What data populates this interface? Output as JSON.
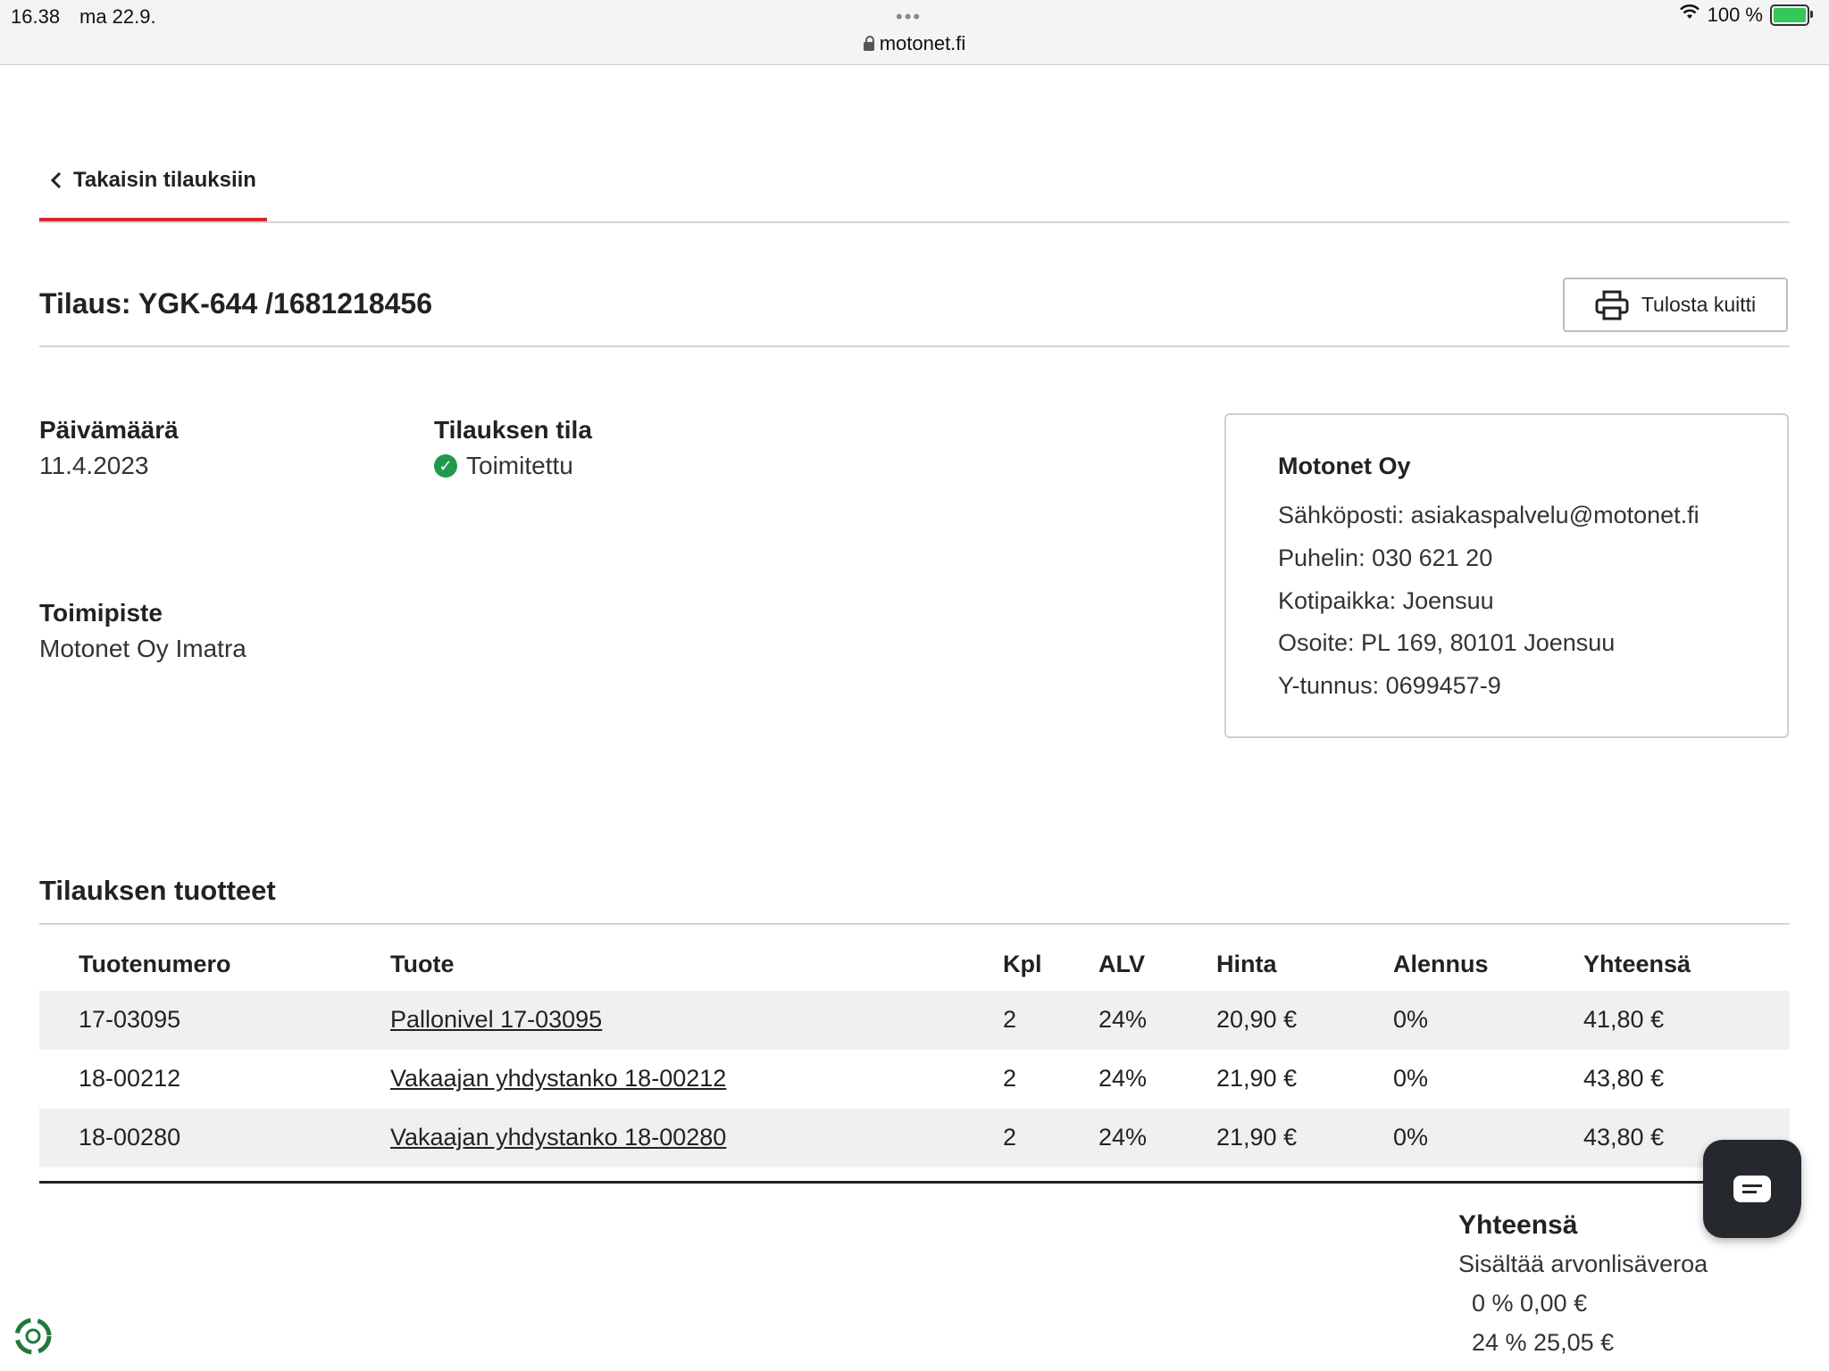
{
  "status_bar": {
    "time": "16.38",
    "date": "ma 22.9.",
    "url": "motonet.fi",
    "battery": "100 %"
  },
  "nav": {
    "back_label": "Takaisin tilauksiin"
  },
  "order": {
    "title": "Tilaus: YGK-644 /1681218456",
    "print_label": "Tulosta kuitti",
    "date_label": "Päivämäärä",
    "date_value": "11.4.2023",
    "status_label": "Tilauksen tila",
    "status_value": "Toimitettu",
    "store_label": "Toimipiste",
    "store_value": "Motonet Oy Imatra"
  },
  "company": {
    "name": "Motonet Oy",
    "email": "Sähköposti: asiakaspalvelu@motonet.fi",
    "phone": "Puhelin: 030 621 20",
    "domicile": "Kotipaikka: Joensuu",
    "address": "Osoite: PL 169, 80101 Joensuu",
    "business_id": "Y-tunnus: 0699457-9"
  },
  "products": {
    "title": "Tilauksen tuotteet",
    "headers": [
      "Tuotenumero",
      "Tuote",
      "Kpl",
      "ALV",
      "Hinta",
      "Alennus",
      "Yhteensä"
    ],
    "rows": [
      [
        "17-03095",
        "Pallonivel 17-03095",
        "2",
        "24%",
        "20,90 €",
        "0%",
        "41,80 €"
      ],
      [
        "18-00212",
        "Vakaajan yhdystanko 18-00212",
        "2",
        "24%",
        "21,90 €",
        "0%",
        "43,80 €"
      ],
      [
        "18-00280",
        "Vakaajan yhdystanko 18-00280",
        "2",
        "24%",
        "21,90 €",
        "0%",
        "43,80 €"
      ]
    ]
  },
  "totals": {
    "title": "Yhteensä",
    "vat_label": "Sisältää arvonlisäveroa",
    "vat_0": "0 % 0,00 €",
    "vat_24": "24 % 25,05 €"
  },
  "colors": {
    "accent": "#d7262c",
    "status_green": "#1f9a4a",
    "chat_bg": "#25292e"
  }
}
